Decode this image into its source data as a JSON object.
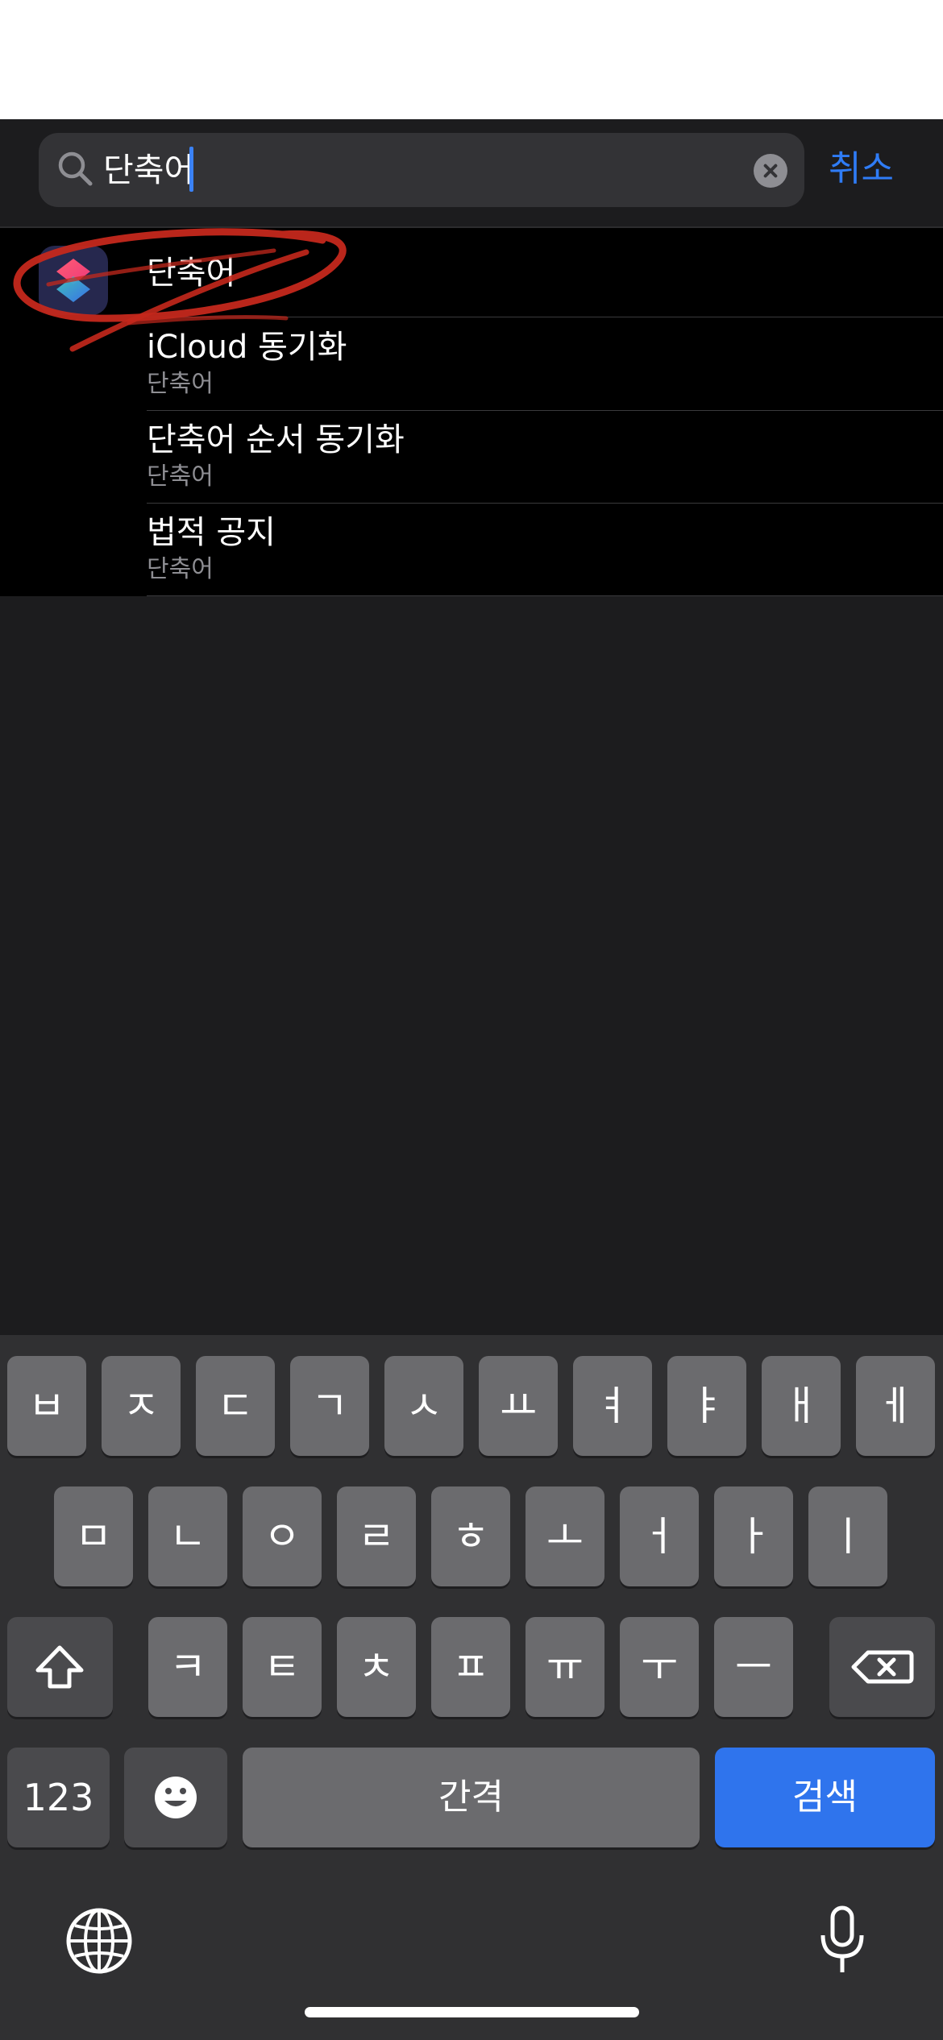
{
  "search": {
    "query": "단축어",
    "cancel_label": "취소"
  },
  "results": {
    "app": {
      "name": "단축어",
      "icon": "shortcuts-app-icon"
    },
    "items": [
      {
        "title": "iCloud 동기화",
        "subtitle": "단축어"
      },
      {
        "title": "단축어 순서 동기화",
        "subtitle": "단축어"
      },
      {
        "title": "법적 공지",
        "subtitle": "단축어"
      }
    ]
  },
  "annotation": {
    "color": "#c4281c"
  },
  "keyboard": {
    "row1": [
      "ㅂ",
      "ㅈ",
      "ㄷ",
      "ㄱ",
      "ㅅ",
      "ㅛ",
      "ㅕ",
      "ㅑ",
      "ㅐ",
      "ㅔ"
    ],
    "row2": [
      "ㅁ",
      "ㄴ",
      "ㅇ",
      "ㄹ",
      "ㅎ",
      "ㅗ",
      "ㅓ",
      "ㅏ",
      "ㅣ"
    ],
    "row3": [
      "ㅋ",
      "ㅌ",
      "ㅊ",
      "ㅍ",
      "ㅠ",
      "ㅜ",
      "ㅡ"
    ],
    "numbers_label": "123",
    "space_label": "간격",
    "search_label": "검색",
    "icons": [
      "shift-icon",
      "backspace-icon",
      "emoji-icon",
      "globe-icon",
      "microphone-icon"
    ]
  },
  "colors": {
    "accent": "#2f7cf6",
    "search_key": "#2f74ed"
  }
}
